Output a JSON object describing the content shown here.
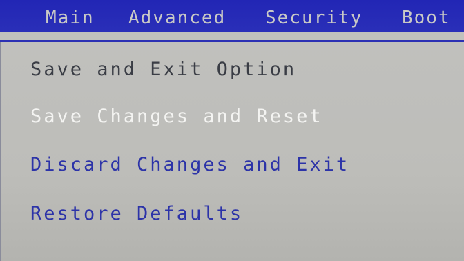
{
  "menu": {
    "tabs": [
      {
        "label": "Main"
      },
      {
        "label": "Advanced"
      },
      {
        "label": "Security"
      },
      {
        "label": "Boot"
      }
    ]
  },
  "panel": {
    "section_title": "Save and Exit Option",
    "options": [
      {
        "label": "Save Changes and Reset"
      },
      {
        "label": "Discard Changes and Exit"
      },
      {
        "label": "Restore Defaults"
      }
    ]
  },
  "colors": {
    "menu_bar": "#2226b5",
    "panel_bg": "#bdbdb9",
    "highlight_text": "#f4f4f2",
    "option_text": "#2c33a8",
    "header_text": "#3a3d45"
  }
}
